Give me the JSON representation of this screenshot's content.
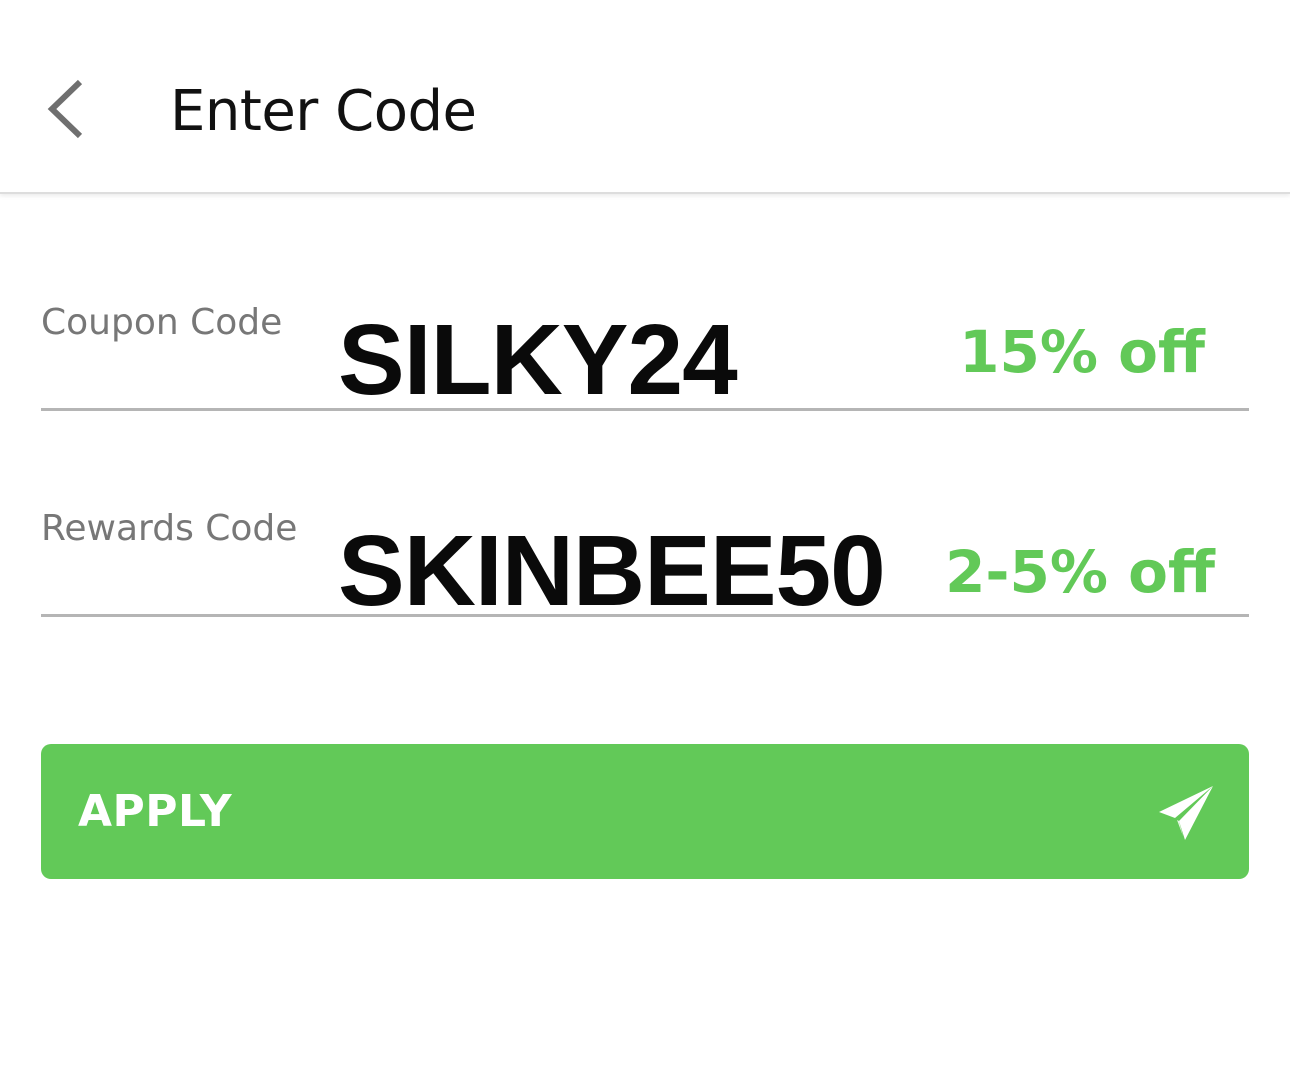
{
  "header": {
    "title": "Enter Code",
    "back_icon": "chevron-left-icon"
  },
  "coupon": {
    "label": "Coupon Code",
    "value": "SILKY24",
    "discount": "15% off"
  },
  "rewards": {
    "label": "Rewards Code",
    "value": "SKINBEE50",
    "discount": "2-5% off"
  },
  "apply": {
    "label": "APPLY",
    "icon": "send-icon"
  },
  "colors": {
    "accent": "#62c958",
    "text": "#0a0a0a",
    "label": "#777777",
    "divider": "#b5b5b5"
  }
}
